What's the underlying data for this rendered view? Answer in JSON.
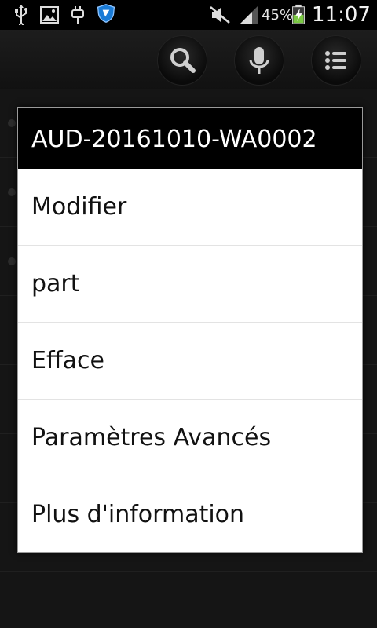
{
  "status_bar": {
    "icons_left": [
      "usb-icon",
      "image-icon",
      "plug-icon",
      "shield-icon"
    ],
    "icons_right": [
      "mute-icon",
      "signal-icon",
      "battery-charging-icon"
    ],
    "battery_percent": "45%",
    "clock": "11:07"
  },
  "toolbar": {
    "buttons": [
      "search-icon",
      "mic-icon",
      "menu-list-icon"
    ]
  },
  "dialog": {
    "title": "AUD-20161010-WA0002",
    "items": [
      {
        "label": "Modifier"
      },
      {
        "label": "part"
      },
      {
        "label": "Efface"
      },
      {
        "label": "Paramètres Avancés"
      },
      {
        "label": "Plus d'information"
      }
    ]
  }
}
